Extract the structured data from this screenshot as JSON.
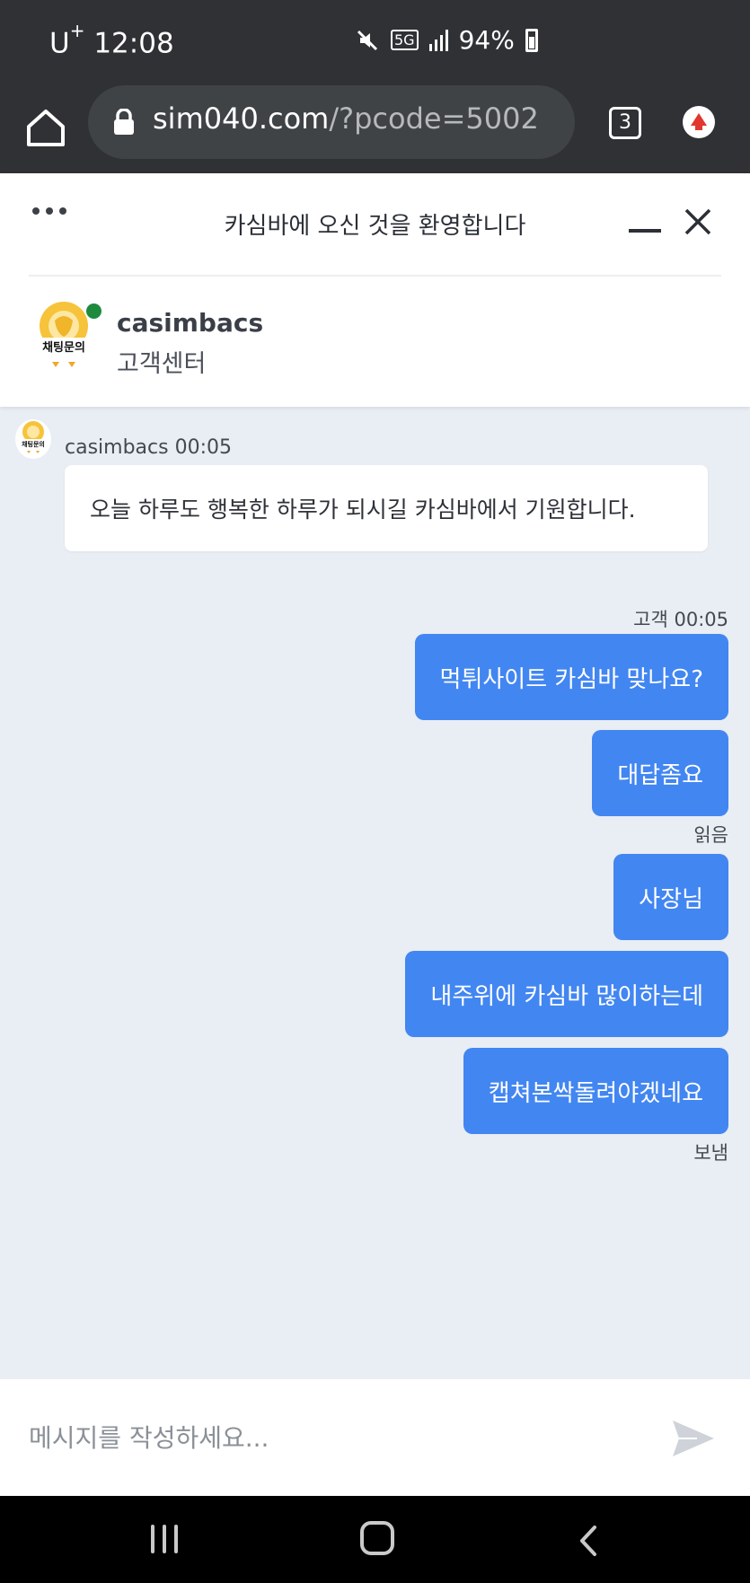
{
  "status_bar": {
    "carrier": "U",
    "carrier_sup": "+",
    "time": "12:08",
    "network": "5G",
    "battery": "94%"
  },
  "browser": {
    "url_domain": "sim040.com",
    "url_path": "/?pcode=5002",
    "tab_count": "3"
  },
  "chat_header": {
    "title": "카심바에 오신 것을 환영합니다",
    "agent_name": "casimbacs",
    "agent_subtitle": "고객센터",
    "avatar_text": "채팅문의"
  },
  "messages": {
    "incoming": {
      "meta": "casimbacs 00:05",
      "text": "오늘 하루도 행복한 하루가 되시길 카심바에서 기원합니다."
    },
    "outgoing_meta": "고객 00:05",
    "outgoing": [
      "먹튀사이트 카심바 맞나요?",
      "대답좀요",
      "사장님",
      "내주위에 카심바 많이하는데",
      "캡쳐본싹돌려야겠네요"
    ],
    "read_label": "읽음",
    "sent_label": "보냄"
  },
  "composer": {
    "placeholder": "메시지를 작성하세요..."
  },
  "colors": {
    "accent": "#4286f1",
    "online": "#1f8a3e",
    "chat_bg": "#e9edf4",
    "status_bar": "#2f3134"
  }
}
